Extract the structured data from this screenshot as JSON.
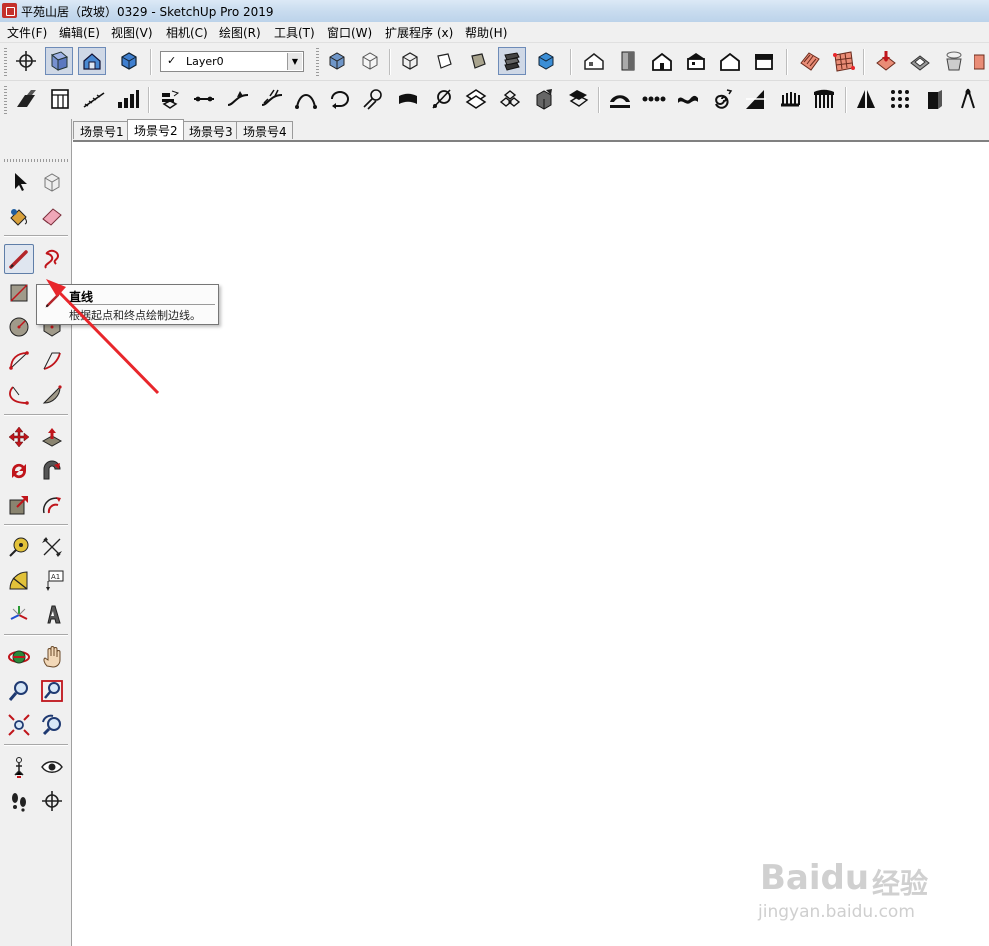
{
  "window": {
    "title": "平苑山居（改坡）0329 - SketchUp Pro 2019"
  },
  "menu": [
    {
      "label": "文件(F)"
    },
    {
      "label": "编辑(E)"
    },
    {
      "label": "视图(V)"
    },
    {
      "label": "相机(C)"
    },
    {
      "label": "绘图(R)"
    },
    {
      "label": "工具(T)"
    },
    {
      "label": "窗口(W)"
    },
    {
      "label": "扩展程序 (x)"
    },
    {
      "label": "帮助(H)"
    }
  ],
  "layer": {
    "check": "✓",
    "value": "Layer0"
  },
  "scenes": [
    {
      "label": "场景号1",
      "active": false
    },
    {
      "label": "场景号2",
      "active": true
    },
    {
      "label": "场景号3",
      "active": false
    },
    {
      "label": "场景号4",
      "active": false
    }
  ],
  "tooltip": {
    "title": "直线",
    "description": "根据起点和终点绘制边线。"
  },
  "left_toolbar": {
    "active_tool": "line-tool"
  },
  "watermark": {
    "logo": "Baidu",
    "brand": "经验",
    "url": "jingyan.baidu.com"
  },
  "colors": {
    "accent_red": "#e8262b",
    "pressed_border": "#5f7ea8",
    "title_bar": "#c9dcef"
  }
}
